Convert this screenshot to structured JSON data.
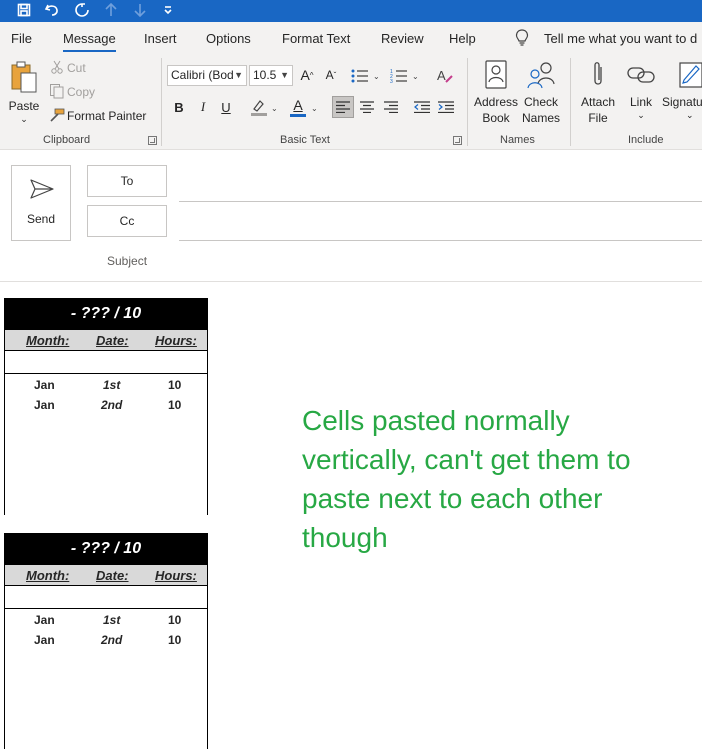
{
  "menu_tabs": [
    "File",
    "Message",
    "Insert",
    "Options",
    "Format Text",
    "Review",
    "Help"
  ],
  "active_tab": "Message",
  "tell_me": "Tell me what you want to d",
  "ribbon": {
    "clipboard": {
      "paste": "Paste",
      "cut": "Cut",
      "copy": "Copy",
      "format_painter": "Format Painter",
      "label": "Clipboard"
    },
    "basic_text": {
      "font_name": "Calibri (Bod",
      "font_size": "10.5",
      "bold": "B",
      "italic": "I",
      "underline": "U",
      "font_color_letter": "A",
      "label": "Basic Text"
    },
    "names": {
      "address_book": [
        "Address",
        "Book"
      ],
      "check_names": [
        "Check",
        "Names"
      ],
      "label": "Names"
    },
    "include": {
      "attach_file": [
        "Attach",
        "File"
      ],
      "link": "Link",
      "signature": "Signatu",
      "label": "Include"
    }
  },
  "compose": {
    "send": "Send",
    "to": "To",
    "cc": "Cc",
    "subject": "Subject"
  },
  "tables": [
    {
      "title": "- ??? / 10",
      "headers": [
        "Month:",
        "Date:",
        "Hours:"
      ],
      "rows": [
        [
          "Jan",
          "1st",
          "10"
        ],
        [
          "Jan",
          "2nd",
          "10"
        ]
      ]
    },
    {
      "title": "- ??? / 10",
      "headers": [
        "Month:",
        "Date:",
        "Hours:"
      ],
      "rows": [
        [
          "Jan",
          "1st",
          "10"
        ],
        [
          "Jan",
          "2nd",
          "10"
        ]
      ]
    }
  ],
  "annotation": "Cells pasted normally vertically, can't get them to paste next to each other though",
  "colors": {
    "title_bar": "#1967c4",
    "annotation_text": "#27a844",
    "ribbon_bg": "#f3f2f1"
  }
}
